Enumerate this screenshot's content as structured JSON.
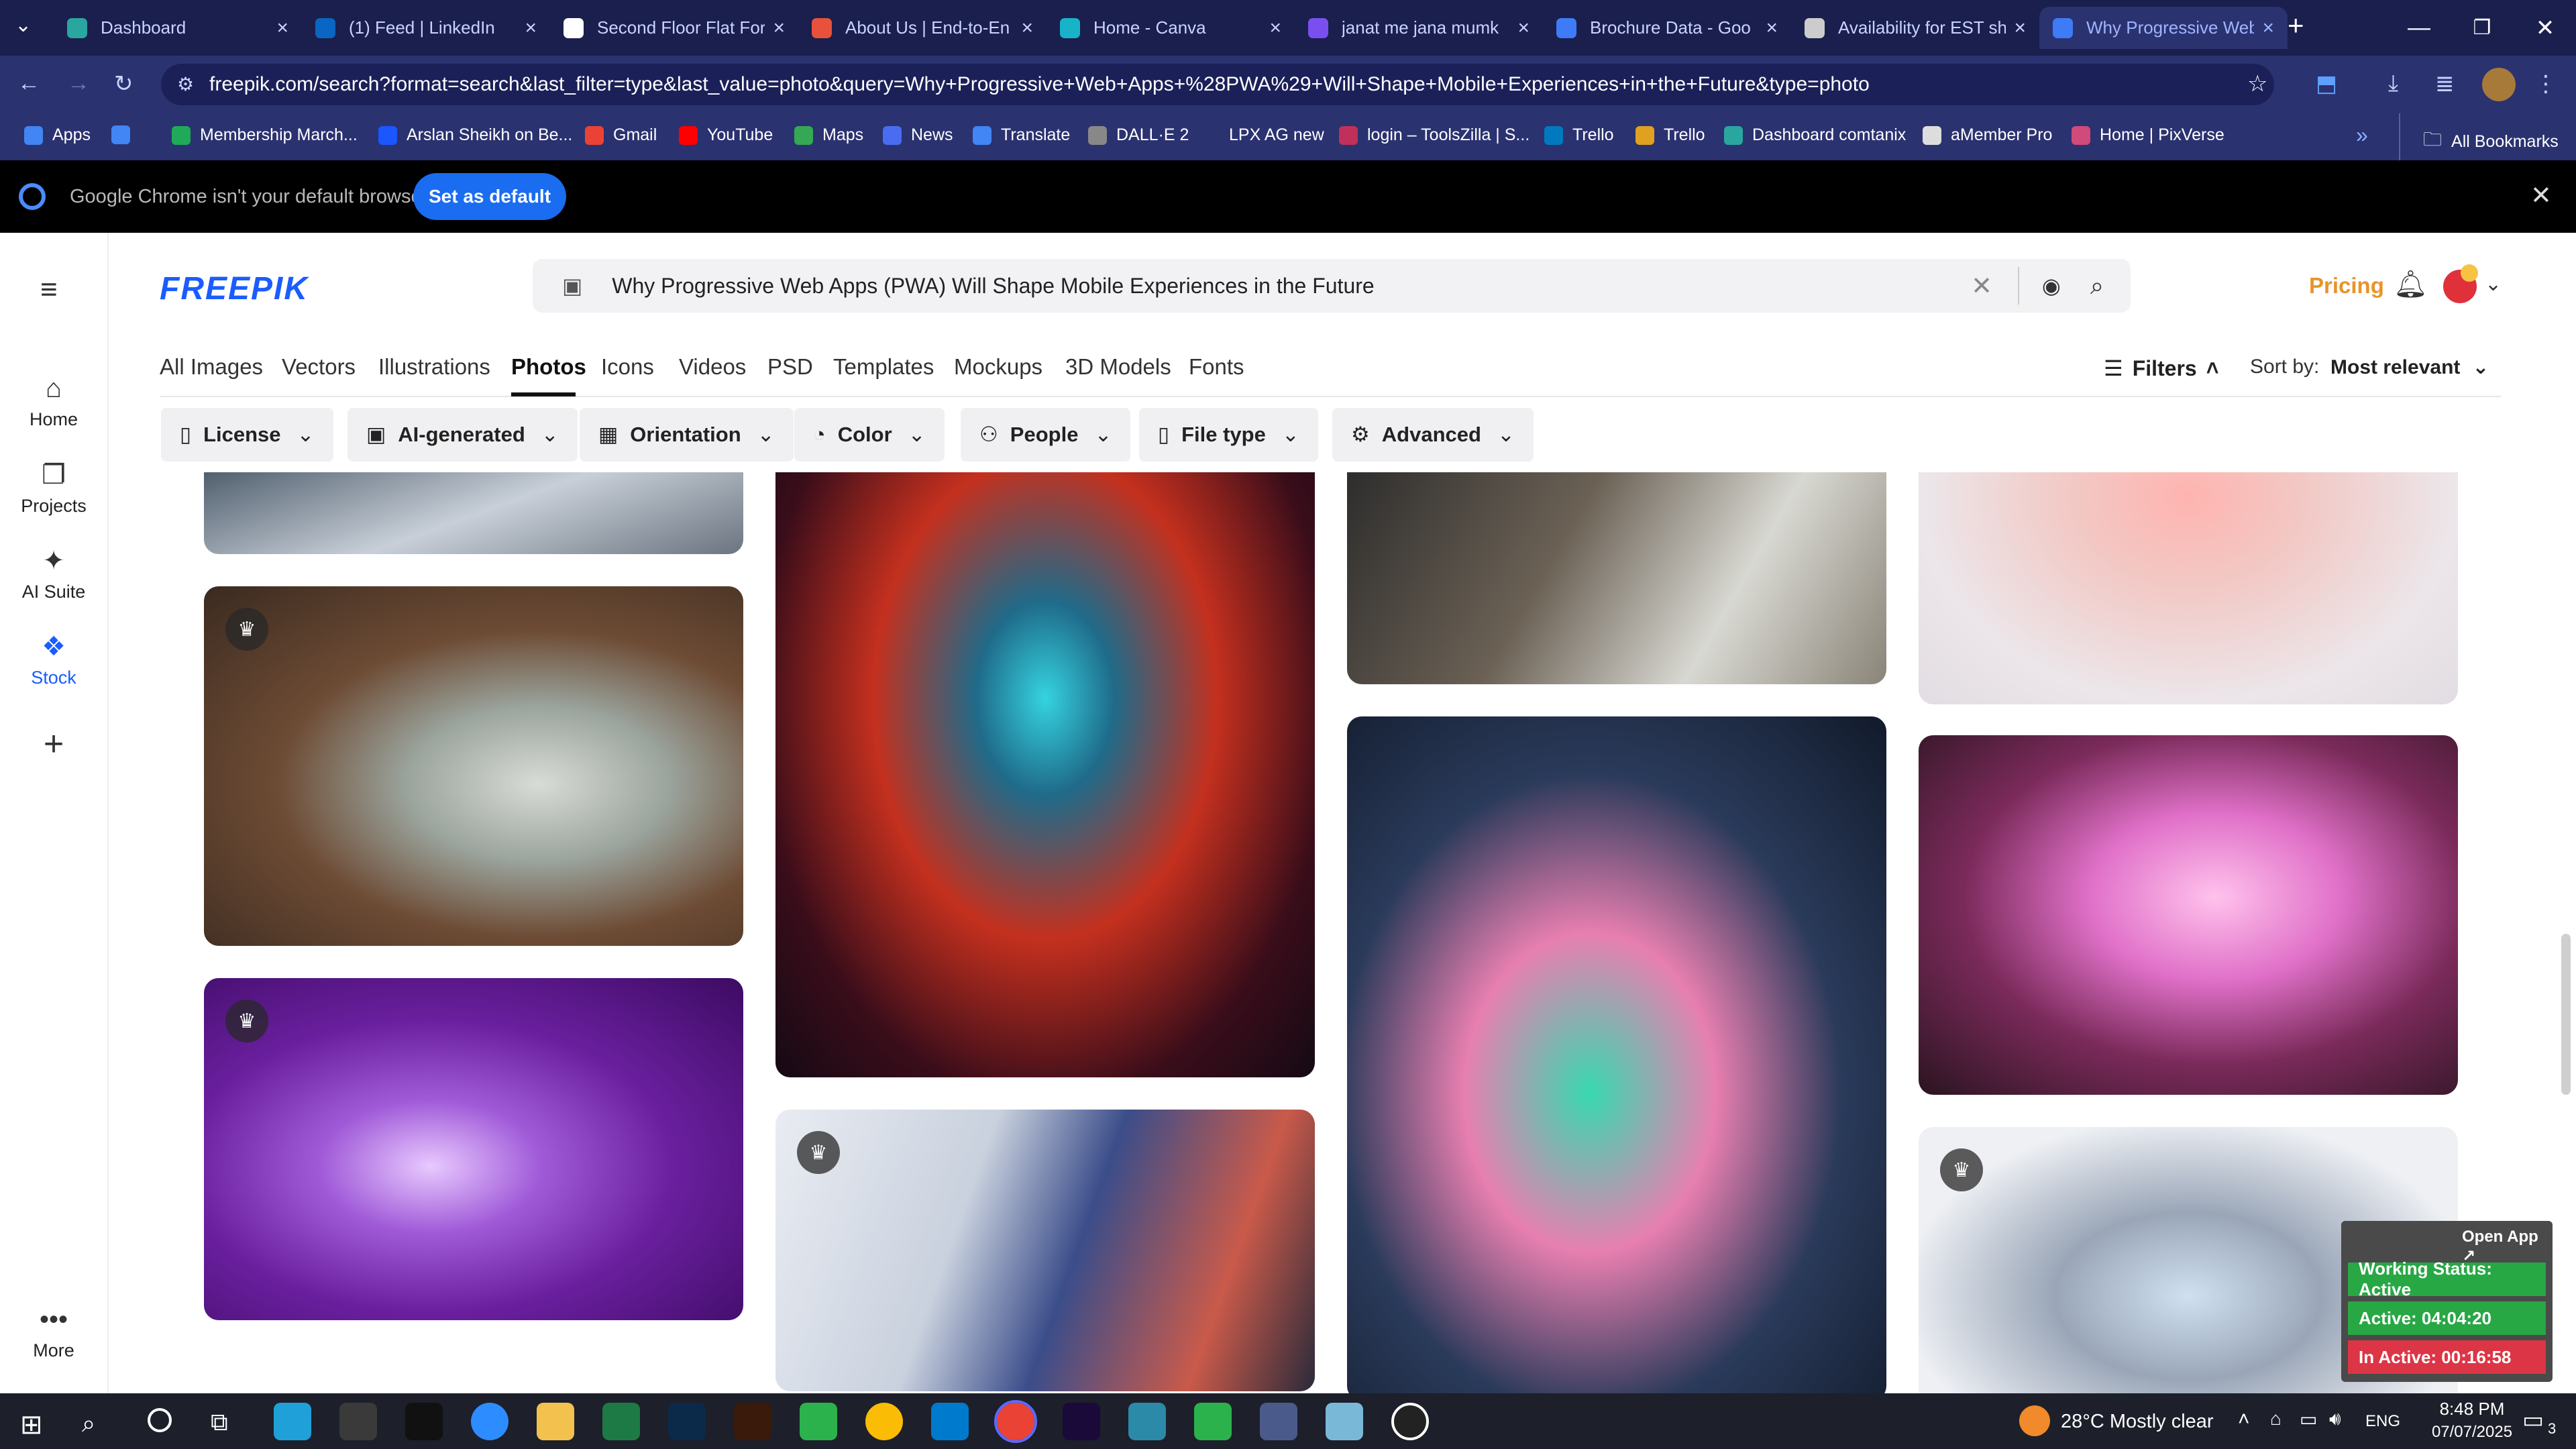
{
  "browser": {
    "tabs": [
      {
        "label": "Dashboard",
        "color": "#2aa6a0"
      },
      {
        "label": "(1) Feed | LinkedIn",
        "color": "#0a66c2"
      },
      {
        "label": "Second Floor Flat For",
        "color": "#ffffff"
      },
      {
        "label": "About Us | End-to-En",
        "color": "#e8513b"
      },
      {
        "label": "Home - Canva",
        "color": "#19b3c9"
      },
      {
        "label": "janat me jana mumk",
        "color": "#7a4ff0"
      },
      {
        "label": "Brochure Data - Goo",
        "color": "#3d7bf7"
      },
      {
        "label": "Availability for EST sh",
        "color": "#cccccc"
      },
      {
        "label": "Why Progressive Web",
        "color": "#3d7bf7"
      }
    ],
    "new_tab": "+",
    "url": "freepik.com/search?format=search&last_filter=type&last_value=photo&query=Why+Progressive+Web+Apps+%28PWA%29+Will+Shape+Mobile+Experiences+in+the+Future&type=photo",
    "bookmarks": [
      {
        "label": "Apps",
        "color": "#4285f4"
      },
      {
        "label": "",
        "color": "#4285f4"
      },
      {
        "label": "Membership March...",
        "color": "#1faa5a"
      },
      {
        "label": "Arslan Sheikh on Be...",
        "color": "#1a57ff"
      },
      {
        "label": "Gmail",
        "color": "#ea4335"
      },
      {
        "label": "YouTube",
        "color": "#ff0000"
      },
      {
        "label": "Maps",
        "color": "#34a853"
      },
      {
        "label": "News",
        "color": "#4a6cf0"
      },
      {
        "label": "Translate",
        "color": "#4285f4"
      },
      {
        "label": "DALL·E 2",
        "color": "#888888"
      },
      {
        "label": "LPX AG new",
        "color": "#2b3270"
      },
      {
        "label": "login – ToolsZilla | S...",
        "color": "#c0305a"
      },
      {
        "label": "Trello",
        "color": "#0079bf"
      },
      {
        "label": "Trello",
        "color": "#e0a020"
      },
      {
        "label": "Dashboard comtanix",
        "color": "#2aa6a0"
      },
      {
        "label": "aMember Pro",
        "color": "#dddddd"
      },
      {
        "label": "Home | PixVerse",
        "color": "#d04a7a"
      }
    ],
    "all_bookmarks": "All Bookmarks",
    "infobar": {
      "message": "Google Chrome isn't your default browser",
      "button": "Set as default"
    }
  },
  "sidebar": {
    "items": [
      {
        "label": "Home"
      },
      {
        "label": "Projects"
      },
      {
        "label": "AI Suite"
      },
      {
        "label": "Stock"
      },
      {
        "label": ""
      },
      {
        "label": "More"
      }
    ]
  },
  "header": {
    "logo": "FREEPIK",
    "search_query": "Why Progressive Web Apps (PWA) Will Shape Mobile Experiences in the Future",
    "pricing": "Pricing"
  },
  "categories": [
    "All Images",
    "Vectors",
    "Illustrations",
    "Photos",
    "Icons",
    "Videos",
    "PSD",
    "Templates",
    "Mockups",
    "3D Models",
    "Fonts"
  ],
  "selected_category": "Photos",
  "filters_label": "Filters",
  "sort": {
    "label": "Sort by:",
    "value": "Most relevant"
  },
  "filter_chips": [
    "License",
    "AI-generated",
    "Orientation",
    "Color",
    "People",
    "File type",
    "Advanced"
  ],
  "widget": {
    "open_app": "Open App ↗",
    "status": "Working Status: Active",
    "active": "Active: 04:04:20",
    "inactive": "In Active: 00:16:58",
    "colors": {
      "status": "#28a745",
      "active": "#28a745",
      "inactive": "#dc3545"
    }
  },
  "taskbar": {
    "weather": "28°C  Mostly clear",
    "lang": "ENG",
    "time": "8:48 PM",
    "date": "07/07/2025",
    "notifications": "3"
  }
}
